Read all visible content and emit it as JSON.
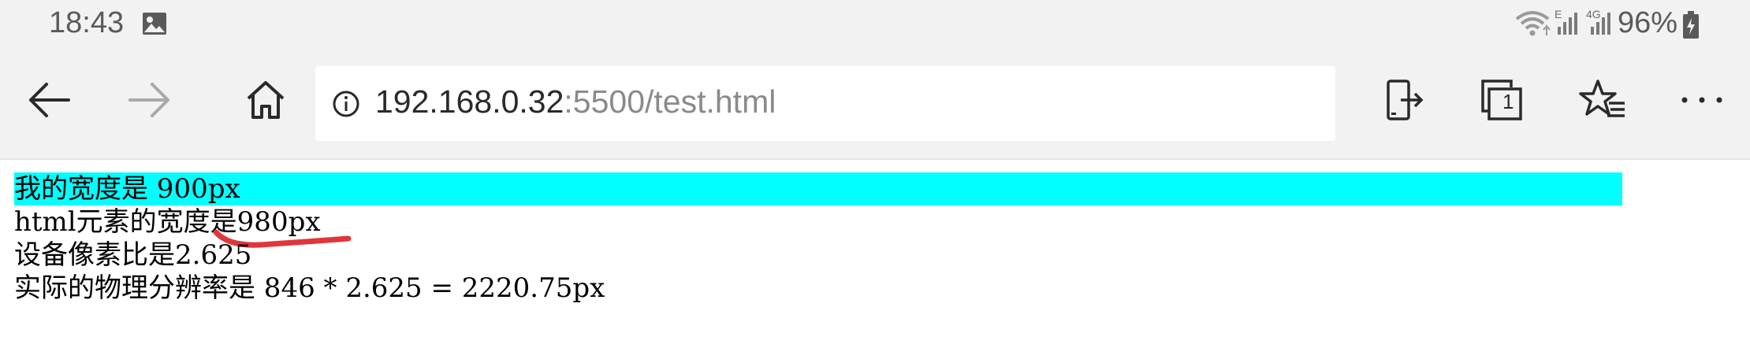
{
  "status_bar": {
    "time": "18:43",
    "battery_percent": "96%",
    "network_label": "4G",
    "network_label_e": "E"
  },
  "toolbar": {
    "url_host": "192.168.0.32",
    "url_rest": ":5500/test.html",
    "tab_count": "1"
  },
  "page": {
    "line1": "我的宽度是 900px",
    "line2": "html元素的宽度是980px",
    "line3": "设备像素比是2.625",
    "line4": "实际的物理分辨率是 846 * 2.625 = 2220.75px",
    "highlight_color": "#00ffff",
    "annotation_color": "#e0363a"
  }
}
